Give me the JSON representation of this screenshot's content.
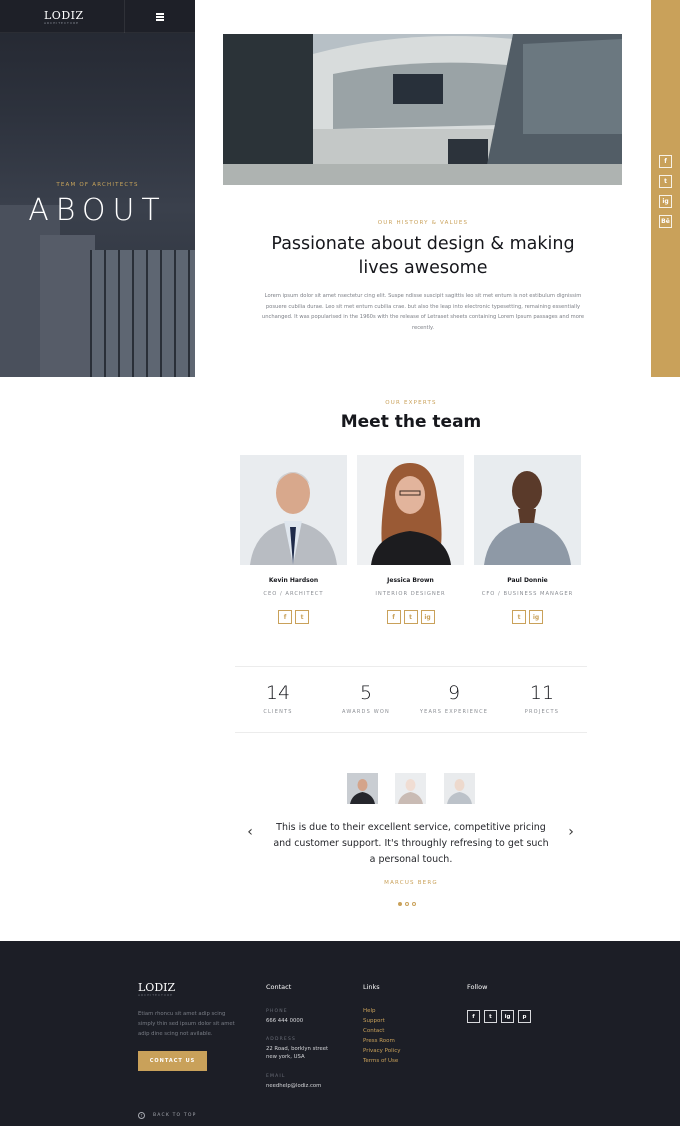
{
  "hero": {
    "logo": "LODIZ",
    "logo_sub": "ARCHITECTURE",
    "kicker": "TEAM OF ARCHITECTS",
    "title": "ABOUT"
  },
  "social_strip": {
    "icons": [
      "f",
      "t",
      "ig",
      "Bē"
    ]
  },
  "about": {
    "kicker": "OUR HISTORY & VALUES",
    "heading": "Passionate about design & making lives awesome",
    "paragraph": "Lorem ipsum dolor sit amet nsectetur cing elit. Suspe ndisse suscipit sagittis leo sit met entum is not estibulum dignissim posuere cubilia durae. Leo sit met entum cubilia crae. but also the leap into electronic typesetting, remaining essentially unchanged. It was popularised in the 1960s with the release of Letraset sheets containing Lorem Ipsum passages and more recently."
  },
  "team": {
    "kicker": "OUR EXPERTS",
    "heading": "Meet the team",
    "members": [
      {
        "name": "Kevin Hardson",
        "role": "CEO / ARCHITECT",
        "socials": [
          "f",
          "t"
        ]
      },
      {
        "name": "Jessica Brown",
        "role": "INTERIOR DESIGNER",
        "socials": [
          "f",
          "t",
          "ig"
        ]
      },
      {
        "name": "Paul Donnie",
        "role": "CFO / BUSINESS MANAGER",
        "socials": [
          "t",
          "ig"
        ]
      }
    ]
  },
  "stats": [
    {
      "number": "14",
      "label": "CLIENTS"
    },
    {
      "number": "5",
      "label": "AWARDS WON"
    },
    {
      "number": "9",
      "label": "YEARS EXPERIENCE"
    },
    {
      "number": "11",
      "label": "PROJECTS"
    }
  ],
  "testimonial": {
    "quote": "This is due to their excellent service, competitive pricing and customer support. It's throughly refresing to get such a personal touch.",
    "author": "MARCUS BERG",
    "prev_arrow": "‹",
    "next_arrow": "›",
    "active_index": 1
  },
  "footer": {
    "logo": "LODIZ",
    "logo_sub": "ARCHITECTURE",
    "about": "Etiam rhoncu sit amet adip scing simply thin sed ipsum dolor sit amet adip dine scing not avilable.",
    "contact_button": "CONTACT US",
    "contact_title": "Contact",
    "phone_label": "PHONE",
    "phone": "666 444 0000",
    "address_label": "ADDRESS",
    "address_line1": "22 Road, borklyn street",
    "address_line2": "new york, USA",
    "email_label": "EMAIL",
    "email": "needhelp@lodiz.com",
    "links_title": "Links",
    "links": [
      "Help",
      "Support",
      "Contact",
      "Press Room",
      "Privacy Policy",
      "Terms of Use"
    ],
    "follow_title": "Follow",
    "follow_icons": [
      "f",
      "t",
      "ig",
      "p"
    ],
    "back_to_top": "BACK TO TOP"
  },
  "colors": {
    "accent": "#c9a15a",
    "footer_bg": "#1c1e26",
    "hero_bg": "#2d323d"
  }
}
